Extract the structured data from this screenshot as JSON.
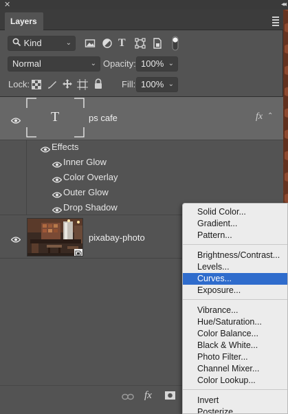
{
  "panel": {
    "tab_label": "Layers",
    "filter": {
      "kind_label": "Kind"
    },
    "blend": {
      "mode": "Normal",
      "opacity_label": "Opacity:",
      "opacity_value": "100%"
    },
    "lock": {
      "lock_label": "Lock:",
      "fill_label": "Fill:",
      "fill_value": "100%"
    }
  },
  "layers": {
    "text_layer": {
      "name": "ps cafe",
      "thumb_glyph": "T",
      "fx_glyph": "fx"
    },
    "effects_label": "Effects",
    "effects": [
      "Inner Glow",
      "Color Overlay",
      "Outer Glow",
      "Drop Shadow"
    ],
    "photo_layer": {
      "name": "pixabay-photo"
    }
  },
  "bottom": {
    "fx_glyph": "fx"
  },
  "context_menu": {
    "items": [
      "Solid Color...",
      "Gradient...",
      "Pattern...",
      "Brightness/Contrast...",
      "Levels...",
      "Curves...",
      "Exposure...",
      "Vibrance...",
      "Hue/Saturation...",
      "Color Balance...",
      "Black & White...",
      "Photo Filter...",
      "Channel Mixer...",
      "Color Lookup...",
      "Invert",
      "Posterize..."
    ],
    "selected": "Curves..."
  },
  "colors": {
    "panel": "#535353",
    "selected_row": "#676767",
    "menu_highlight": "#2f6ccc"
  }
}
